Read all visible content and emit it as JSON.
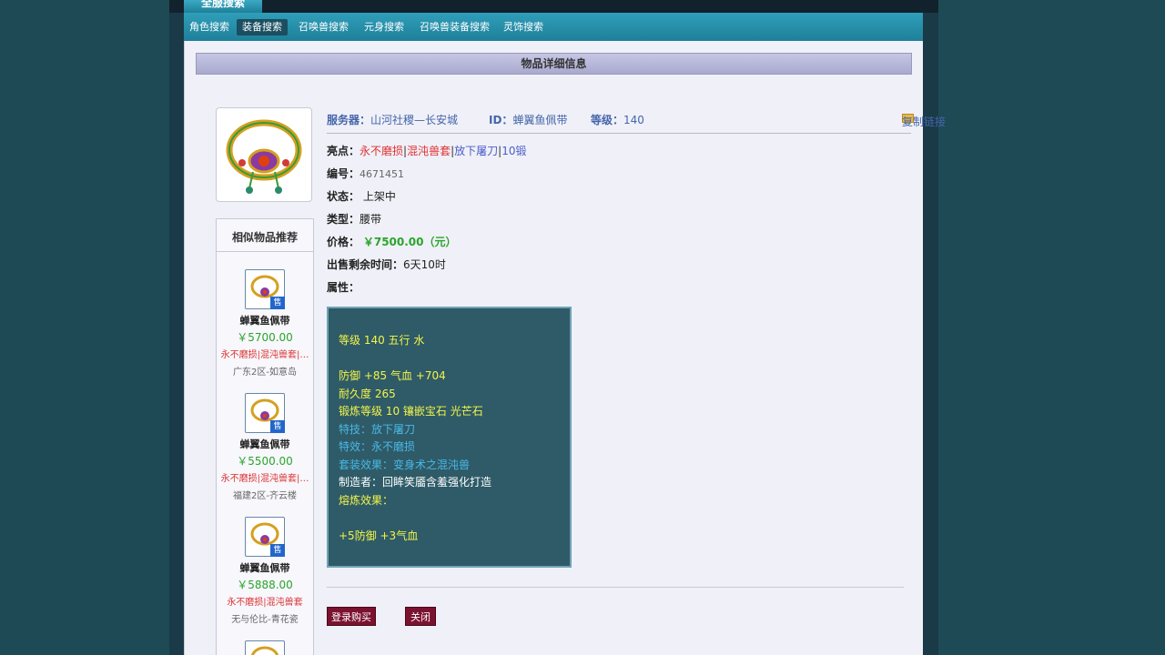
{
  "header": {
    "tab": "全服搜索"
  },
  "nav": {
    "items": [
      {
        "label": "角色搜索"
      },
      {
        "label": "装备搜索"
      },
      {
        "label": "召唤兽搜索"
      },
      {
        "label": "元身搜索"
      },
      {
        "label": "召唤兽装备搜索"
      },
      {
        "label": "灵饰搜索"
      }
    ],
    "active": "装备搜索"
  },
  "panel": {
    "title": "物品详细信息"
  },
  "item": {
    "server_label": "服务器：",
    "server": "山河社稷—长安城",
    "id_label": "ID：",
    "id": "蝉翼鱼佩带",
    "level_label": "等级：",
    "level": "140",
    "copy_link": "复制链接",
    "highlights_label": "亮点：",
    "highlights": [
      "永不磨损",
      "混沌兽套",
      "放下屠刀",
      "10锻"
    ],
    "number_label": "编号：",
    "number": "4671451",
    "status_label": "状态：",
    "status": "上架中",
    "type_label": "类型：",
    "type": "腰带",
    "price_label": "价格：",
    "price": "￥7500.00（元）",
    "time_label": "出售剩余时间：",
    "time": "6天10时",
    "attr_label": "属性："
  },
  "attributes": [
    {
      "text": "等级 140 五行 水",
      "color": "yellow"
    },
    {
      "text": "",
      "color": "yellow"
    },
    {
      "text": "防御 +85 气血 +704",
      "color": "yellow"
    },
    {
      "text": "耐久度 265",
      "color": "yellow"
    },
    {
      "text": "锻炼等级 10 镶嵌宝石 光芒石",
      "color": "yellow"
    },
    {
      "text": "特技：放下屠刀",
      "color": "cyan"
    },
    {
      "text": "特效：永不磨损",
      "color": "cyan"
    },
    {
      "text": "套装效果：变身术之混沌兽",
      "color": "cyan"
    },
    {
      "text": "制造者：回眸笑靥含羞强化打造",
      "color": "white"
    },
    {
      "text": "熔炼效果：",
      "color": "yellow"
    },
    {
      "text": "",
      "color": "yellow"
    },
    {
      "text": "+5防御 +3气血",
      "color": "yellow"
    }
  ],
  "similar": {
    "title": "相似物品推荐",
    "sale_badge": "售",
    "items": [
      {
        "name": "蝉翼鱼佩带",
        "price": "￥5700.00",
        "tags": "永不磨损|混沌兽套|…",
        "server": "广东2区-如意岛"
      },
      {
        "name": "蝉翼鱼佩带",
        "price": "￥5500.00",
        "tags": "永不磨损|混沌兽套|…",
        "server": "福建2区-齐云楼"
      },
      {
        "name": "蝉翼鱼佩带",
        "price": "￥5888.00",
        "tags": "永不磨损|混沌兽套",
        "server": "无与伦比-青花瓷"
      }
    ]
  },
  "buttons": {
    "buy": "登录购买",
    "close": "关闭"
  }
}
